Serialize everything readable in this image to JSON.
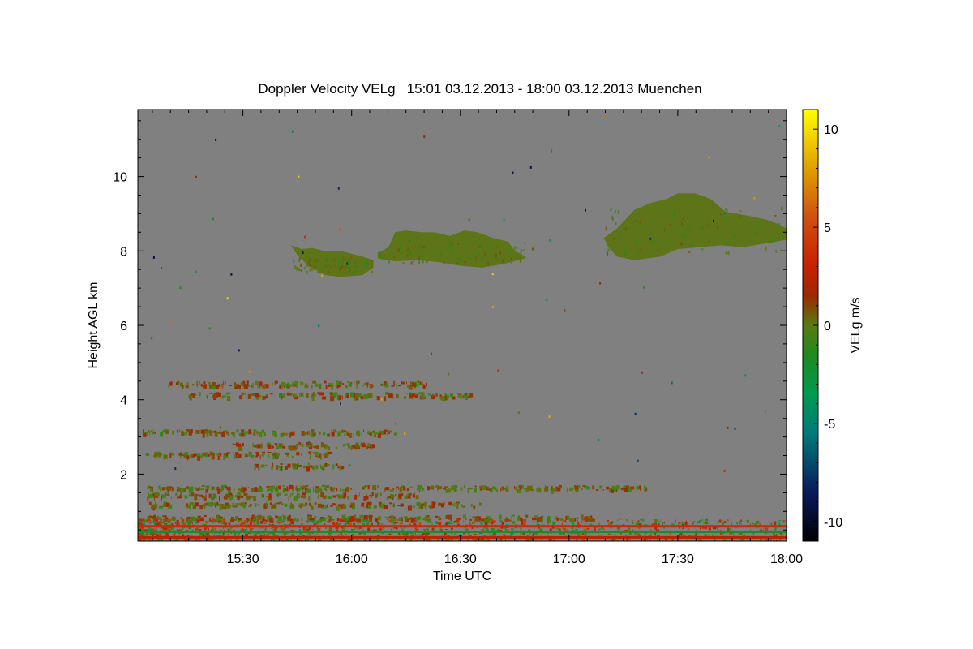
{
  "chart_data": {
    "type": "heatmap",
    "title": "Doppler Velocity VELg   15:01 03.12.2013 - 18:00 03.12.2013 Muenchen",
    "xlabel": "Time UTC",
    "ylabel": "Height AGL km",
    "colorbar_label": "VELg m/s",
    "x_range_hours": [
      15.0167,
      18.0
    ],
    "y_range_km": [
      0.2,
      11.8
    ],
    "c_range": [
      -11,
      11
    ],
    "x_ticks": [
      {
        "value": 15.5,
        "label": "15:30"
      },
      {
        "value": 16.0,
        "label": "16:00"
      },
      {
        "value": 16.5,
        "label": "16:30"
      },
      {
        "value": 17.0,
        "label": "17:00"
      },
      {
        "value": 17.5,
        "label": "17:30"
      },
      {
        "value": 18.0,
        "label": "18:00"
      }
    ],
    "y_ticks": [
      {
        "value": 2,
        "label": "2"
      },
      {
        "value": 4,
        "label": "4"
      },
      {
        "value": 6,
        "label": "6"
      },
      {
        "value": 8,
        "label": "8"
      },
      {
        "value": 10,
        "label": "10"
      }
    ],
    "colorbar_ticks": [
      {
        "value": 10,
        "label": "10"
      },
      {
        "value": 5,
        "label": "5"
      },
      {
        "value": 0,
        "label": "0"
      },
      {
        "value": -5,
        "label": "-5"
      },
      {
        "value": -10,
        "label": "-10"
      }
    ],
    "colorscale": [
      {
        "v": -11,
        "color": "#000000"
      },
      {
        "v": -8.5,
        "color": "#0a1a5c"
      },
      {
        "v": -5.5,
        "color": "#007a7a"
      },
      {
        "v": -3.5,
        "color": "#009a50"
      },
      {
        "v": -1.5,
        "color": "#1f8a1f"
      },
      {
        "v": 0,
        "color": "#5a7a10"
      },
      {
        "v": 1.5,
        "color": "#9a2a00"
      },
      {
        "v": 3,
        "color": "#c82000"
      },
      {
        "v": 5.5,
        "color": "#d05010"
      },
      {
        "v": 8,
        "color": "#e0a000"
      },
      {
        "v": 11,
        "color": "#ffff00"
      }
    ],
    "background_color": "#808080",
    "cloud_color": "#5e7418",
    "cloud_layers": [
      {
        "name": "cloud-1",
        "top": [
          [
            15.72,
            8.15
          ],
          [
            15.77,
            8.05
          ],
          [
            15.82,
            8.08
          ],
          [
            15.87,
            8.0
          ],
          [
            15.95,
            8.0
          ],
          [
            16.05,
            7.85
          ],
          [
            16.1,
            7.75
          ]
        ],
        "base": [
          [
            15.75,
            7.9
          ],
          [
            15.8,
            7.6
          ],
          [
            15.88,
            7.35
          ],
          [
            15.95,
            7.3
          ],
          [
            16.05,
            7.35
          ],
          [
            16.1,
            7.55
          ]
        ]
      },
      {
        "name": "cloud-2",
        "top": [
          [
            16.12,
            7.95
          ],
          [
            16.17,
            8.1
          ],
          [
            16.2,
            8.5
          ],
          [
            16.25,
            8.55
          ],
          [
            16.32,
            8.5
          ],
          [
            16.38,
            8.5
          ],
          [
            16.45,
            8.4
          ],
          [
            16.52,
            8.55
          ],
          [
            16.58,
            8.5
          ],
          [
            16.65,
            8.35
          ],
          [
            16.72,
            8.25
          ],
          [
            16.75,
            8.0
          ],
          [
            16.8,
            7.85
          ]
        ],
        "base": [
          [
            16.12,
            7.8
          ],
          [
            16.2,
            7.72
          ],
          [
            16.3,
            7.75
          ],
          [
            16.4,
            7.7
          ],
          [
            16.5,
            7.6
          ],
          [
            16.6,
            7.55
          ],
          [
            16.7,
            7.65
          ],
          [
            16.8,
            7.8
          ]
        ]
      },
      {
        "name": "cloud-3",
        "top": [
          [
            17.16,
            8.35
          ],
          [
            17.22,
            8.6
          ],
          [
            17.3,
            9.1
          ],
          [
            17.38,
            9.3
          ],
          [
            17.45,
            9.4
          ],
          [
            17.5,
            9.55
          ],
          [
            17.58,
            9.55
          ],
          [
            17.65,
            9.4
          ],
          [
            17.72,
            9.05
          ],
          [
            17.82,
            8.95
          ],
          [
            17.9,
            8.85
          ],
          [
            17.95,
            8.75
          ],
          [
            18.0,
            8.6
          ]
        ],
        "base": [
          [
            17.18,
            8.1
          ],
          [
            17.22,
            7.85
          ],
          [
            17.3,
            7.75
          ],
          [
            17.42,
            7.85
          ],
          [
            17.5,
            8.05
          ],
          [
            17.6,
            8.1
          ],
          [
            17.7,
            8.15
          ],
          [
            17.8,
            8.1
          ],
          [
            17.9,
            8.2
          ],
          [
            18.0,
            8.3
          ]
        ]
      }
    ],
    "speckle_bands_km": [
      {
        "height": 4.45,
        "x0": 15.15,
        "x1": 16.35
      },
      {
        "height": 4.15,
        "x0": 15.25,
        "x1": 16.55
      },
      {
        "height": 3.15,
        "x0": 15.02,
        "x1": 16.2
      },
      {
        "height": 2.8,
        "x0": 15.45,
        "x1": 16.1
      },
      {
        "height": 2.55,
        "x0": 15.05,
        "x1": 15.9
      },
      {
        "height": 2.25,
        "x0": 15.55,
        "x1": 16.0
      },
      {
        "height": 1.65,
        "x0": 15.05,
        "x1": 17.35
      },
      {
        "height": 1.45,
        "x0": 15.05,
        "x1": 16.3
      },
      {
        "height": 1.2,
        "x0": 15.05,
        "x1": 16.6
      },
      {
        "height": 0.85,
        "x0": 15.02,
        "x1": 17.1
      }
    ],
    "surface_bands_km": [
      {
        "height": 0.6,
        "value": 3.5
      },
      {
        "height": 0.45,
        "value": -2.0
      },
      {
        "height": 0.3,
        "value": 2.5
      }
    ]
  }
}
